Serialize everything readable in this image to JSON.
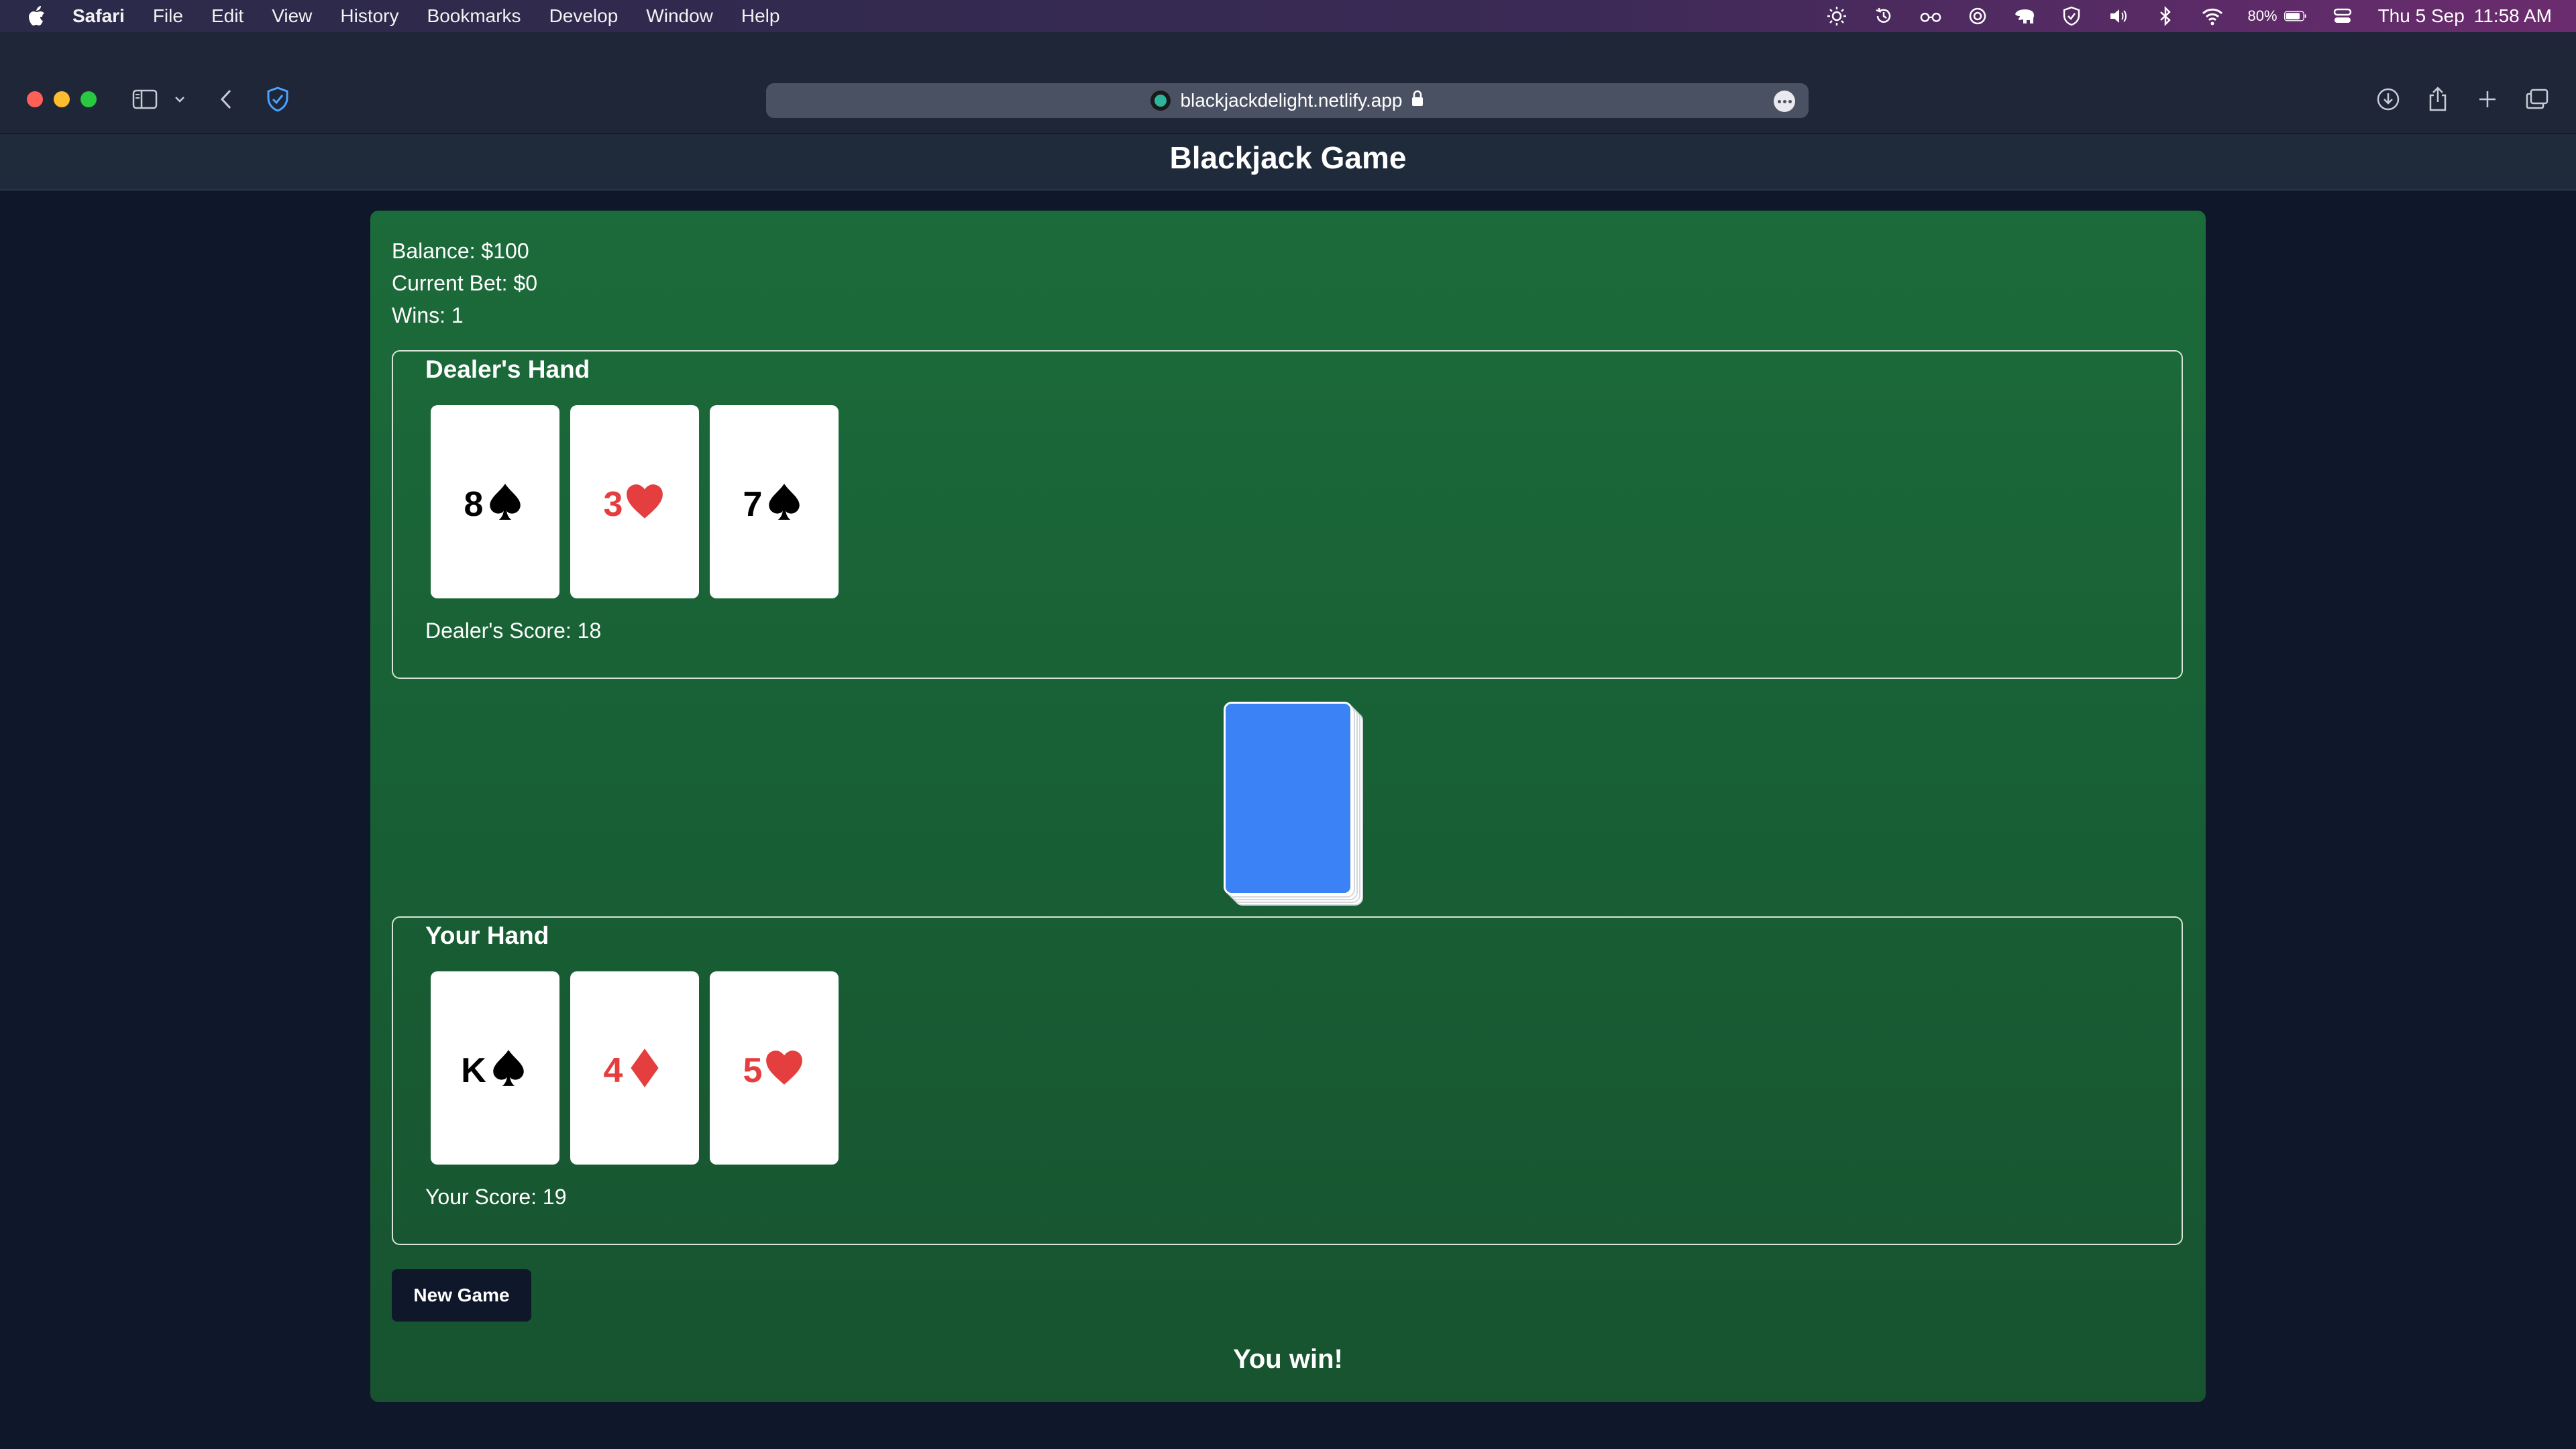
{
  "menubar": {
    "app_name": "Safari",
    "items": [
      "File",
      "Edit",
      "View",
      "History",
      "Bookmarks",
      "Develop",
      "Window",
      "Help"
    ],
    "battery": "80%",
    "date": "Thu 5 Sep",
    "time": "11:58 AM"
  },
  "browser": {
    "url": "blackjackdelight.netlify.app"
  },
  "page": {
    "title": "Blackjack Game"
  },
  "stats": {
    "balance": "Balance: $100",
    "current_bet": "Current Bet: $0",
    "wins": "Wins: 1"
  },
  "dealer": {
    "title": "Dealer's Hand",
    "cards": [
      {
        "rank": "8",
        "suit": "spade",
        "color": "#000000"
      },
      {
        "rank": "3",
        "suit": "heart",
        "color": "#e53e3e"
      },
      {
        "rank": "7",
        "suit": "spade",
        "color": "#000000"
      }
    ],
    "score": "Dealer's Score: 18"
  },
  "player": {
    "title": "Your Hand",
    "cards": [
      {
        "rank": "K",
        "suit": "spade",
        "color": "#000000"
      },
      {
        "rank": "4",
        "suit": "diamond",
        "color": "#e53e3e"
      },
      {
        "rank": "5",
        "suit": "heart",
        "color": "#e53e3e"
      }
    ],
    "score": "Your Score: 19"
  },
  "controls": {
    "new_game_label": "New Game"
  },
  "result": "You win!",
  "colors": {
    "table_green": "#1c6b3a",
    "card_back": "#3b82f6",
    "red_suit": "#e53e3e",
    "button_bg": "#0f172a"
  }
}
